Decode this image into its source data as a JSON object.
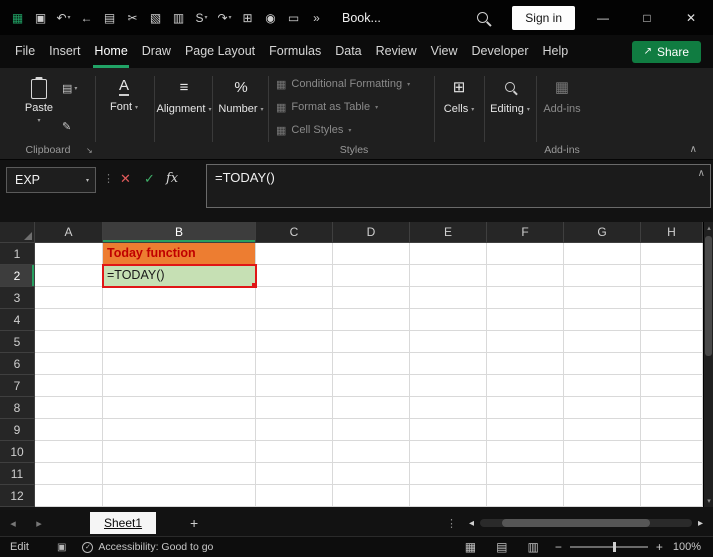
{
  "titlebar": {
    "icons": [
      {
        "name": "excel-app-icon",
        "glyph": "▦",
        "color": "#21A366"
      },
      {
        "name": "save-icon",
        "glyph": "▣"
      },
      {
        "name": "undo-icon",
        "glyph": "↶",
        "dropdown": true
      },
      {
        "name": "back-icon",
        "glyph": "←"
      },
      {
        "name": "copy-icon",
        "glyph": "▤"
      },
      {
        "name": "cut-icon",
        "glyph": "✂"
      },
      {
        "name": "picture-icon",
        "glyph": "▧"
      },
      {
        "name": "layout-icon",
        "glyph": "▥"
      },
      {
        "name": "style-icon",
        "glyph": "S",
        "dropdown": true
      },
      {
        "name": "redo-icon",
        "glyph": "↷",
        "dropdown": true
      },
      {
        "name": "table-icon",
        "glyph": "⊞"
      },
      {
        "name": "camera-icon",
        "glyph": "◉"
      },
      {
        "name": "window-icon",
        "glyph": "▭"
      },
      {
        "name": "overflow-icon",
        "glyph": "»"
      }
    ],
    "dropdown_glyph": "▾",
    "workbook_name": "Book...",
    "sign_in_label": "Sign in",
    "minimize_glyph": "—",
    "maximize_glyph": "□",
    "close_glyph": "✕"
  },
  "menu": {
    "items": [
      "File",
      "Insert",
      "Home",
      "Draw",
      "Page Layout",
      "Formulas",
      "Data",
      "Review",
      "View",
      "Developer",
      "Help"
    ],
    "active": "Home",
    "share_label": "Share",
    "share_icon_glyph": "↗"
  },
  "ribbon": {
    "paste_label": "Paste",
    "copy_icon_glyph": "▤",
    "format_painter_glyph": "✎",
    "font_label": "Font",
    "font_icon_glyph": "A",
    "alignment_label": "Alignment",
    "alignment_icon_glyph": "≡",
    "number_label": "Number",
    "number_icon_glyph": "%",
    "styles_items": [
      "Conditional Formatting",
      "Format as Table",
      "Cell Styles"
    ],
    "styles_item_icon_glyph": "▦",
    "cells_label": "Cells",
    "cells_icon_glyph": "⊞",
    "editing_label": "Editing",
    "addins_label": "Add-ins",
    "addins_icon_glyph": "▦",
    "group_labels": {
      "clipboard": "Clipboard",
      "styles": "Styles",
      "addins": "Add-ins"
    },
    "dialog_launcher_glyph": "↘",
    "collapse_glyph": "∧",
    "dropdown_glyph": "▾"
  },
  "formula_bar": {
    "name_box": "EXP",
    "dots_glyph": "⋮",
    "cancel_glyph": "✕",
    "enter_glyph": "✓",
    "fx_label": "fx",
    "formula": "=TODAY()",
    "expand_glyph": "∧"
  },
  "grid": {
    "columns": [
      "A",
      "B",
      "C",
      "D",
      "E",
      "F",
      "G",
      "H"
    ],
    "rows": [
      "1",
      "2",
      "3",
      "4",
      "5",
      "6",
      "7",
      "8",
      "9",
      "10",
      "11",
      "12"
    ],
    "selected_column": "B",
    "selected_row": "2",
    "cells": {
      "B1": {
        "text": "Today function",
        "bg": "#ED7D31",
        "color": "#C00000",
        "bold": true
      },
      "B2": {
        "text": "=TODAY()",
        "bg": "#C6E0B4",
        "color": "#1a1a1a",
        "selected": true
      }
    }
  },
  "sheet_bar": {
    "prev_glyph": "◂",
    "next_glyph": "▸",
    "tabs": [
      {
        "name": "Sheet1",
        "active": true
      }
    ],
    "add_glyph": "+",
    "dots_glyph": "⋮",
    "scroll_left_glyph": "◂",
    "scroll_right_glyph": "▸"
  },
  "status_bar": {
    "mode": "Edit",
    "macro_icon_glyph": "▣",
    "accessibility_check_glyph": "✓",
    "accessibility": "Accessibility: Good to go",
    "view_icons": [
      {
        "name": "normal-view-icon",
        "glyph": "▦"
      },
      {
        "name": "page-layout-view-icon",
        "glyph": "▤"
      },
      {
        "name": "page-break-view-icon",
        "glyph": "▥"
      }
    ],
    "zoom_out_glyph": "−",
    "zoom_in_glyph": "+",
    "zoom": "100%"
  },
  "colors": {
    "accent_green": "#107C41",
    "selection_red": "#E01616",
    "b1_fill": "#ED7D31",
    "b1_text": "#C00000",
    "b2_fill": "#C6E0B4"
  }
}
